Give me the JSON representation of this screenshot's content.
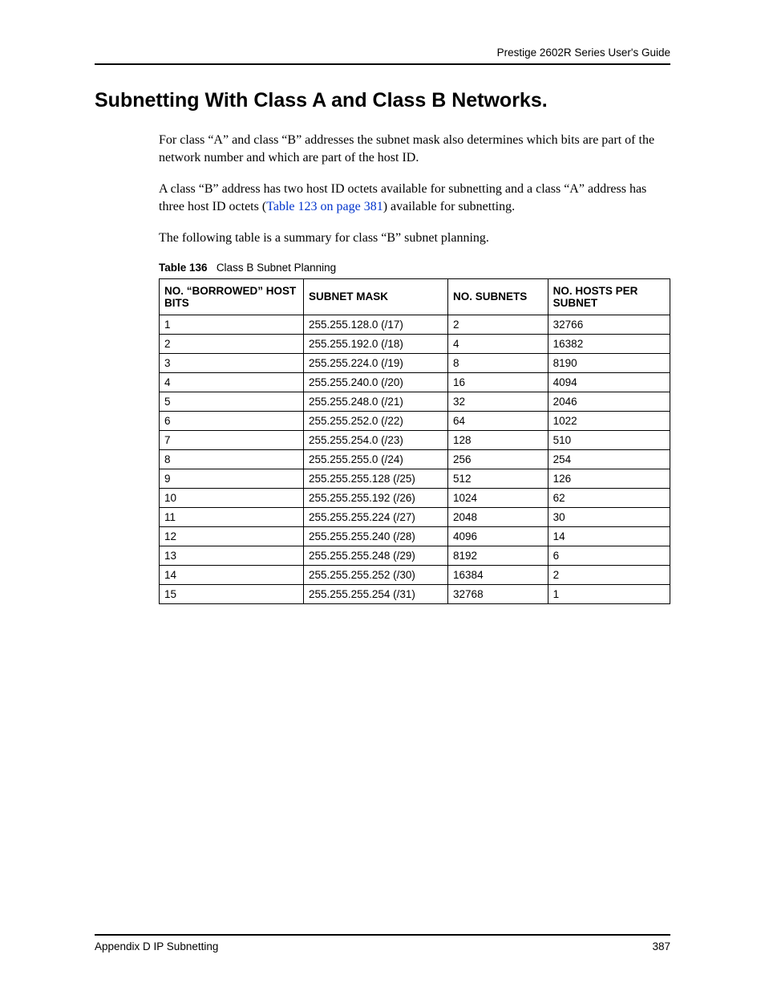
{
  "header": {
    "running_head": "Prestige 2602R Series User's Guide"
  },
  "section": {
    "title": "Subnetting With Class A and Class B Networks."
  },
  "paragraphs": {
    "p1": "For class “A” and class “B” addresses the subnet mask also determines which bits are part of the network number and which are part of the host ID.",
    "p2a": "A class “B” address has two host ID octets available for subnetting and a class “A” address has three host ID octets (",
    "p2_link": "Table 123 on page 381",
    "p2b": ") available for subnetting.",
    "p3": "The following table is a summary for class “B” subnet planning."
  },
  "table_caption": {
    "label": "Table 136",
    "text": "Class B Subnet Planning"
  },
  "table": {
    "headers": {
      "bits": "NO. “BORROWED” HOST BITS",
      "mask": "SUBNET MASK",
      "subnets": "NO. SUBNETS",
      "hosts": "NO. HOSTS PER SUBNET"
    },
    "rows": [
      {
        "bits": "1",
        "mask": "255.255.128.0 (/17)",
        "subnets": "2",
        "hosts": "32766"
      },
      {
        "bits": "2",
        "mask": "255.255.192.0 (/18)",
        "subnets": "4",
        "hosts": "16382"
      },
      {
        "bits": "3",
        "mask": "255.255.224.0 (/19)",
        "subnets": "8",
        "hosts": "8190"
      },
      {
        "bits": "4",
        "mask": "255.255.240.0 (/20)",
        "subnets": "16",
        "hosts": "4094"
      },
      {
        "bits": "5",
        "mask": "255.255.248.0 (/21)",
        "subnets": "32",
        "hosts": "2046"
      },
      {
        "bits": "6",
        "mask": "255.255.252.0 (/22)",
        "subnets": "64",
        "hosts": "1022"
      },
      {
        "bits": "7",
        "mask": "255.255.254.0 (/23)",
        "subnets": "128",
        "hosts": "510"
      },
      {
        "bits": "8",
        "mask": "255.255.255.0 (/24)",
        "subnets": "256",
        "hosts": "254"
      },
      {
        "bits": "9",
        "mask": "255.255.255.128 (/25)",
        "subnets": "512",
        "hosts": "126"
      },
      {
        "bits": "10",
        "mask": "255.255.255.192 (/26)",
        "subnets": "1024",
        "hosts": "62"
      },
      {
        "bits": "11",
        "mask": "255.255.255.224 (/27)",
        "subnets": "2048",
        "hosts": "30"
      },
      {
        "bits": "12",
        "mask": "255.255.255.240 (/28)",
        "subnets": "4096",
        "hosts": "14"
      },
      {
        "bits": "13",
        "mask": "255.255.255.248 (/29)",
        "subnets": "8192",
        "hosts": "6"
      },
      {
        "bits": "14",
        "mask": "255.255.255.252 (/30)",
        "subnets": "16384",
        "hosts": "2"
      },
      {
        "bits": "15",
        "mask": "255.255.255.254 (/31)",
        "subnets": "32768",
        "hosts": "1"
      }
    ]
  },
  "footer": {
    "section": "Appendix D IP Subnetting",
    "page": "387"
  }
}
